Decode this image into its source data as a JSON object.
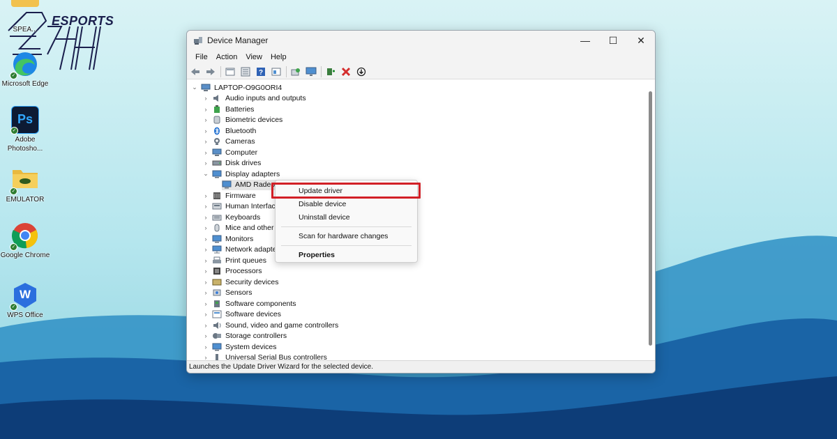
{
  "watermark": {
    "text": "ESPORTS",
    "number": "24H"
  },
  "desktop_icons": [
    {
      "label": "SPEA...",
      "icon": "folder-icon"
    },
    {
      "label": "Microsoft Edge",
      "icon": "edge-icon"
    },
    {
      "label": "Adobe Photosho...",
      "icon": "photoshop-icon",
      "glyph": "Ps"
    },
    {
      "label": "EMULATOR",
      "icon": "folder-icon"
    },
    {
      "label": "Google Chrome",
      "icon": "chrome-icon"
    },
    {
      "label": "WPS Office",
      "icon": "wps-icon",
      "glyph": "W"
    }
  ],
  "window": {
    "title": "Device Manager",
    "buttons": {
      "minimize": "—",
      "maximize": "☐",
      "close": "✕"
    },
    "menu": [
      "File",
      "Action",
      "View",
      "Help"
    ],
    "toolbar": [
      "back-icon",
      "forward-icon",
      "properties-icon",
      "view-icon",
      "help-icon",
      "view2-icon",
      "refresh-icon",
      "monitor-icon",
      "add-driver-icon",
      "uninstall-icon",
      "download-icon"
    ],
    "tree": {
      "root": "LAPTOP-O9G0ORI4",
      "items": [
        {
          "label": "Audio inputs and outputs",
          "icon": "speaker-icon",
          "expanded": false
        },
        {
          "label": "Batteries",
          "icon": "battery-icon",
          "expanded": false
        },
        {
          "label": "Biometric devices",
          "icon": "fingerprint-icon",
          "expanded": false
        },
        {
          "label": "Bluetooth",
          "icon": "bluetooth-icon",
          "expanded": false
        },
        {
          "label": "Cameras",
          "icon": "camera-icon",
          "expanded": false
        },
        {
          "label": "Computer",
          "icon": "computer-icon",
          "expanded": false
        },
        {
          "label": "Disk drives",
          "icon": "disk-icon",
          "expanded": false
        },
        {
          "label": "Display adapters",
          "icon": "display-icon",
          "expanded": true
        },
        {
          "label": "AMD Radeo",
          "icon": "display-icon",
          "child": true,
          "selected": true
        },
        {
          "label": "Firmware",
          "icon": "chip-icon",
          "expanded": false
        },
        {
          "label": "Human Interface",
          "icon": "hid-icon",
          "expanded": false
        },
        {
          "label": "Keyboards",
          "icon": "keyboard-icon",
          "expanded": false
        },
        {
          "label": "Mice and other p",
          "icon": "mouse-icon",
          "expanded": false
        },
        {
          "label": "Monitors",
          "icon": "monitor-icon",
          "expanded": false
        },
        {
          "label": "Network adapte",
          "icon": "network-icon",
          "expanded": false
        },
        {
          "label": "Print queues",
          "icon": "printer-icon",
          "expanded": false
        },
        {
          "label": "Processors",
          "icon": "processor-icon",
          "expanded": false
        },
        {
          "label": "Security devices",
          "icon": "security-icon",
          "expanded": false
        },
        {
          "label": "Sensors",
          "icon": "sensor-icon",
          "expanded": false
        },
        {
          "label": "Software components",
          "icon": "component-icon",
          "expanded": false
        },
        {
          "label": "Software devices",
          "icon": "software-icon",
          "expanded": false
        },
        {
          "label": "Sound, video and game controllers",
          "icon": "sound-icon",
          "expanded": false
        },
        {
          "label": "Storage controllers",
          "icon": "storage-icon",
          "expanded": false
        },
        {
          "label": "System devices",
          "icon": "system-icon",
          "expanded": false
        },
        {
          "label": "Universal Serial Bus controllers",
          "icon": "usb-icon",
          "expanded": false
        }
      ]
    },
    "status": "Launches the Update Driver Wizard for the selected device."
  },
  "context_menu": {
    "items": [
      "Update driver",
      "Disable device",
      "Uninstall device",
      "Scan for hardware changes",
      "Properties"
    ],
    "highlighted": "Update driver",
    "highlight_color": "#d21f26"
  }
}
